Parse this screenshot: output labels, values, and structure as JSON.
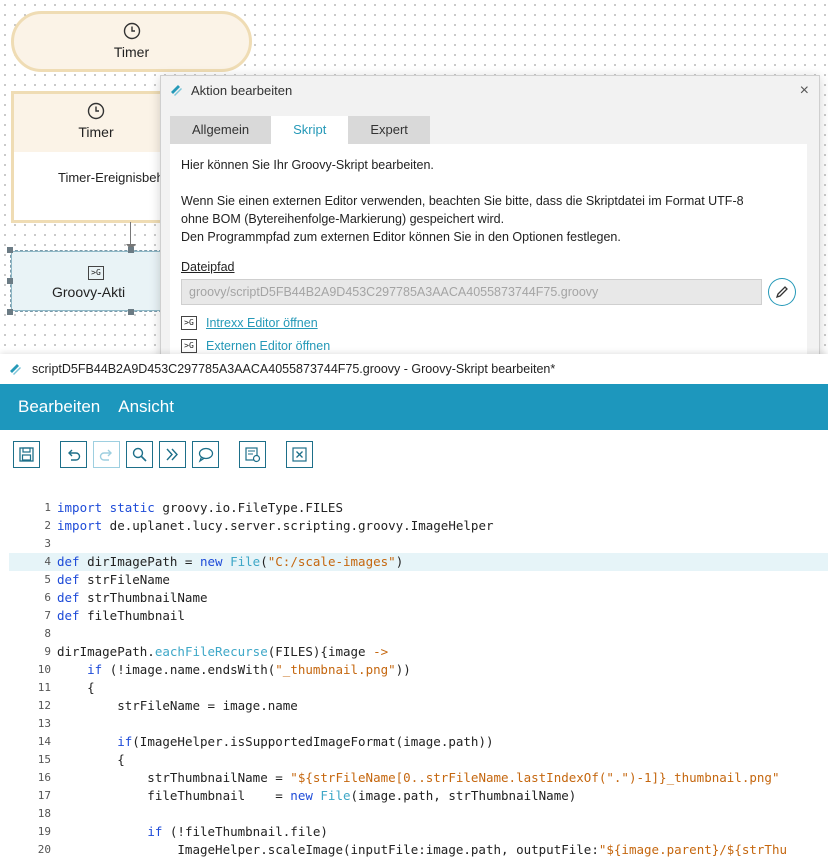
{
  "canvas": {
    "timer_top_label": "Timer",
    "timer_label": "Timer",
    "timer_event_label": "Timer-Ereignisbeh",
    "groovy_action_label": "Groovy-Akti"
  },
  "dialog": {
    "title": "Aktion bearbeiten",
    "close_icon": "×",
    "tabs": [
      "Allgemein",
      "Skript",
      "Expert"
    ],
    "active_tab": "Skript",
    "intro": "Hier können Sie Ihr Groovy-Skript bearbeiten.",
    "info_line1": "Wenn Sie einen externen Editor verwenden, beachten Sie bitte, dass die Skriptdatei im Format UTF-8",
    "info_line2": "ohne BOM (Bytereihenfolge-Markierung) gespeichert wird.",
    "info_line3": "Den Programmpfad zum externen Editor können Sie in den Optionen festlegen.",
    "file_path_label": "Dateipfad",
    "file_path_value": "groovy/scriptD5FB44B2A9D453C297785A3AACA4055873744F75.groovy",
    "open_intrexx_editor": "Intrexx Editor öffnen",
    "open_external_editor": "Externen Editor öffnen"
  },
  "editor": {
    "window_title": "scriptD5FB44B2A9D453C297785A3AACA4055873744F75.groovy - Groovy-Skript bearbeiten*",
    "menu": [
      "Bearbeiten",
      "Ansicht"
    ],
    "toolbar_icons": [
      "save-icon",
      "undo-icon",
      "redo-icon",
      "search-icon",
      "goto-icon",
      "comment-icon",
      "script-info-icon",
      "close-x-icon"
    ],
    "highlighted_line": 4,
    "code_lines": [
      {
        "n": "1",
        "parts": [
          [
            "kw",
            "import static"
          ],
          [
            "",
            " groovy.io.FileType.FILES"
          ]
        ]
      },
      {
        "n": "2",
        "parts": [
          [
            "kw",
            "import"
          ],
          [
            "",
            " de.uplanet.lucy.server.scripting.groovy.ImageHelper"
          ]
        ]
      },
      {
        "n": "3",
        "parts": []
      },
      {
        "n": "4",
        "parts": [
          [
            "kw",
            "def"
          ],
          [
            "",
            " dirImagePath = "
          ],
          [
            "kw",
            "new"
          ],
          [
            "",
            " "
          ],
          [
            "fn",
            "File"
          ],
          [
            "",
            "("
          ],
          [
            "str",
            "\"C:/scale-images\""
          ],
          [
            "",
            ")"
          ]
        ]
      },
      {
        "n": "5",
        "parts": [
          [
            "kw",
            "def"
          ],
          [
            "",
            " strFileName"
          ]
        ]
      },
      {
        "n": "6",
        "parts": [
          [
            "kw",
            "def"
          ],
          [
            "",
            " strThumbnailName"
          ]
        ]
      },
      {
        "n": "7",
        "parts": [
          [
            "kw",
            "def"
          ],
          [
            "",
            " fileThumbnail"
          ]
        ]
      },
      {
        "n": "8",
        "parts": []
      },
      {
        "n": "9",
        "parts": [
          [
            "",
            "dirImagePath."
          ],
          [
            "fn",
            "eachFileRecurse"
          ],
          [
            "",
            "(FILES){image "
          ],
          [
            "str",
            "->"
          ]
        ]
      },
      {
        "n": "10",
        "parts": [
          [
            "",
            "    "
          ],
          [
            "kw",
            "if"
          ],
          [
            "",
            " (!image.name.endsWith("
          ],
          [
            "str",
            "\"_thumbnail.png\""
          ],
          [
            "",
            "))"
          ]
        ]
      },
      {
        "n": "11",
        "parts": [
          [
            "",
            "    {"
          ]
        ]
      },
      {
        "n": "12",
        "parts": [
          [
            "",
            "        strFileName = image.name"
          ]
        ]
      },
      {
        "n": "13",
        "parts": []
      },
      {
        "n": "14",
        "parts": [
          [
            "",
            "        "
          ],
          [
            "kw",
            "if"
          ],
          [
            "",
            "(ImageHelper.isSupportedImageFormat(image.path))"
          ]
        ]
      },
      {
        "n": "15",
        "parts": [
          [
            "",
            "        {"
          ]
        ]
      },
      {
        "n": "16",
        "parts": [
          [
            "",
            "            strThumbnailName = "
          ],
          [
            "str",
            "\"${strFileName[0..strFileName.lastIndexOf(\".\")-1]}_thumbnail.png\""
          ]
        ]
      },
      {
        "n": "17",
        "parts": [
          [
            "",
            "            fileThumbnail    = "
          ],
          [
            "kw",
            "new"
          ],
          [
            "",
            " "
          ],
          [
            "fn",
            "File"
          ],
          [
            "",
            "(image.path, strThumbnailName)"
          ]
        ]
      },
      {
        "n": "18",
        "parts": []
      },
      {
        "n": "19",
        "parts": [
          [
            "",
            "            "
          ],
          [
            "kw",
            "if"
          ],
          [
            "",
            " (!fileThumbnail.file)"
          ]
        ]
      },
      {
        "n": "20",
        "parts": [
          [
            "",
            "                ImageHelper.scaleImage(inputFile:image.path, outputFile:"
          ],
          [
            "str",
            "\"${image.parent}/${strThu"
          ]
        ]
      }
    ]
  }
}
